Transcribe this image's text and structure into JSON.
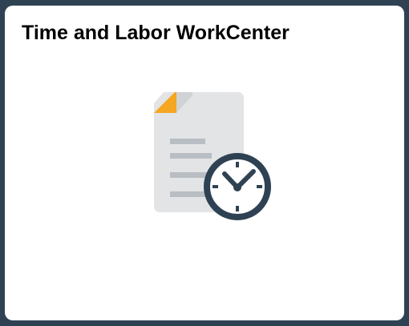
{
  "tile": {
    "title": "Time and Labor WorkCenter",
    "icon": "document-clock-icon"
  },
  "colors": {
    "background": "#2f4253",
    "tile": "#ffffff",
    "document": "#e3e4e5",
    "document_lines": "#b8bec3",
    "page_corner": "#f5a623",
    "clock": "#2f4253"
  }
}
